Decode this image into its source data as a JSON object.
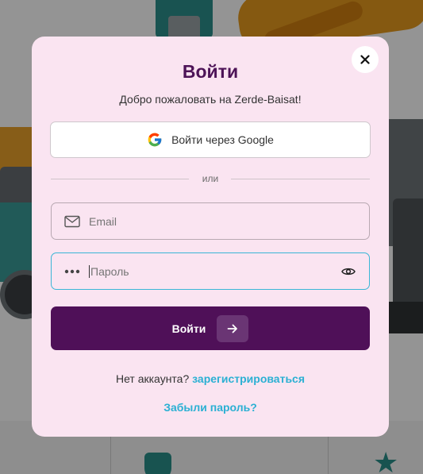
{
  "modal": {
    "title": "Войти",
    "subtitle": "Добро пожаловать на Zerde-Baisat!",
    "close_icon": "close-icon",
    "google_button": {
      "label": "Войти через Google",
      "icon": "google-icon"
    },
    "divider_text": "или",
    "email_field": {
      "placeholder": "Email",
      "value": "",
      "icon": "mail-icon"
    },
    "password_field": {
      "placeholder": "Пароль",
      "value": "",
      "icon": "password-dots-icon",
      "toggle_icon": "eye-icon"
    },
    "submit_button": {
      "label": "Войти",
      "icon": "arrow-right-icon"
    },
    "signup": {
      "question": "Нет аккаунта?",
      "link": "зарегистрироваться"
    },
    "forgot_password": "Забыли пароль?"
  },
  "colors": {
    "modal_background": "#fae4f1",
    "title": "#4d1357",
    "primary_button": "#4f1058",
    "link": "#2bb0d3",
    "focus_border": "#3ab6d6",
    "background_accent_teal": "#2a8f8a",
    "background_accent_orange": "#e69a1e"
  }
}
